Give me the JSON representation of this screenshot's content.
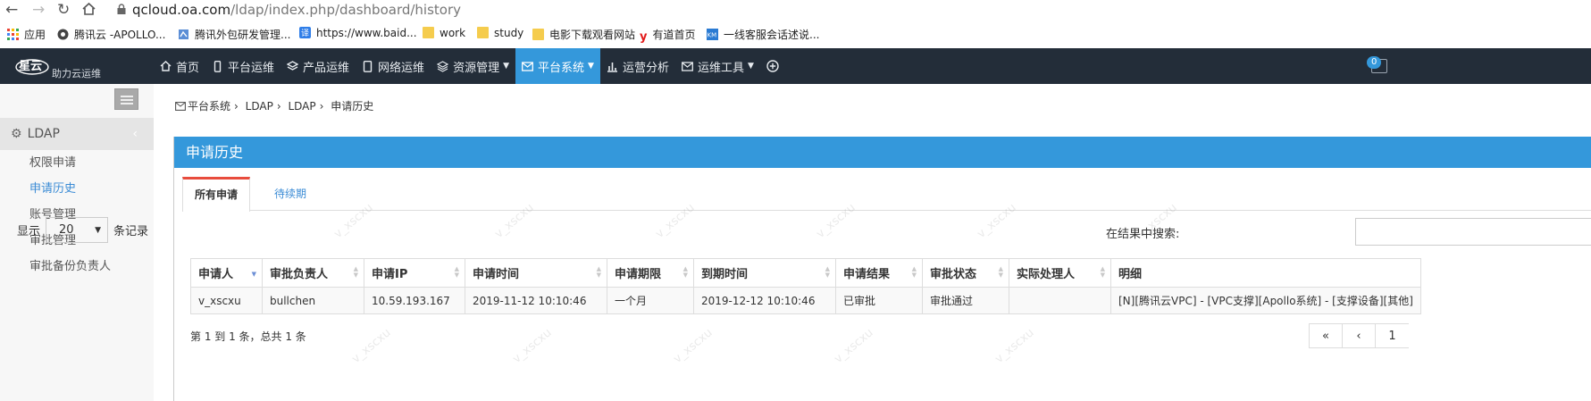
{
  "browser": {
    "url_host": "qcloud.oa.com",
    "url_path": "/ldap/index.php/dashboard/history",
    "bookmarks": [
      {
        "label": "应用",
        "icon": "apps-grid-icon"
      },
      {
        "label": "腾讯云 -APOLLO...",
        "icon": "globe-icon"
      },
      {
        "label": "腾讯外包研发管理...",
        "icon": "page-icon"
      },
      {
        "label": "https://www.baid...",
        "icon": "translate-icon"
      },
      {
        "label": "work",
        "icon": "folder-icon"
      },
      {
        "label": "study",
        "icon": "folder-icon"
      },
      {
        "label": "电影下载观看网站",
        "icon": "folder-icon"
      },
      {
        "label": "有道首页",
        "icon": "youdao-icon"
      },
      {
        "label": "一线客服会话述说...",
        "icon": "km-icon"
      }
    ]
  },
  "topbar": {
    "brand": "星云",
    "subtitle": "助力云运维",
    "menu": [
      {
        "label": "首页",
        "icon": "home-icon"
      },
      {
        "label": "平台运维",
        "icon": "mobile-icon"
      },
      {
        "label": "产品运维",
        "icon": "layers-icon"
      },
      {
        "label": "网络运维",
        "icon": "tablet-icon"
      },
      {
        "label": "资源管理",
        "icon": "stack-icon",
        "caret": true
      },
      {
        "label": "平台系统",
        "icon": "envelope-icon",
        "caret": true,
        "active": true
      },
      {
        "label": "运营分析",
        "icon": "bar-chart-icon"
      },
      {
        "label": "运维工具",
        "icon": "envelope-icon",
        "caret": true
      },
      {
        "label": "",
        "icon": "plus-circle-icon"
      }
    ],
    "notify_count": "0"
  },
  "sidebar": {
    "section": "LDAP",
    "items": [
      "权限申请",
      "申请历史",
      "账号管理",
      "审批管理",
      "审批备份负责人"
    ],
    "active_index": 1
  },
  "breadcrumb": [
    "平台系统",
    "LDAP",
    "LDAP",
    "申请历史"
  ],
  "panel": {
    "title": "申请历史",
    "tabs": [
      "所有申请",
      "待续期"
    ],
    "length_prefix": "显示",
    "length_value": "20",
    "length_suffix": "条记录",
    "search_label": "在结果中搜索:"
  },
  "table": {
    "headers": [
      "申请人",
      "审批负责人",
      "申请IP",
      "申请时间",
      "申请期限",
      "到期时间",
      "申请结果",
      "审批状态",
      "实际处理人",
      "明细"
    ],
    "rows": [
      [
        "v_xscxu",
        "bullchen",
        "10.59.193.167",
        "2019-11-12 10:10:46",
        "一个月",
        "2019-12-12 10:10:46",
        "已审批",
        "审批通过",
        "",
        "[N][腾讯云VPC] - [VPC支撑][Apollo系统] - [支撑设备][其他]"
      ]
    ]
  },
  "footer": {
    "info": "第 1 到 1 条，总共 1 条",
    "pager": [
      "«",
      "‹",
      "1"
    ]
  },
  "watermark": "v_xscxu",
  "colors": {
    "accent": "#3498db",
    "navbar": "#232d39",
    "tab_active": "#e84c3d"
  }
}
